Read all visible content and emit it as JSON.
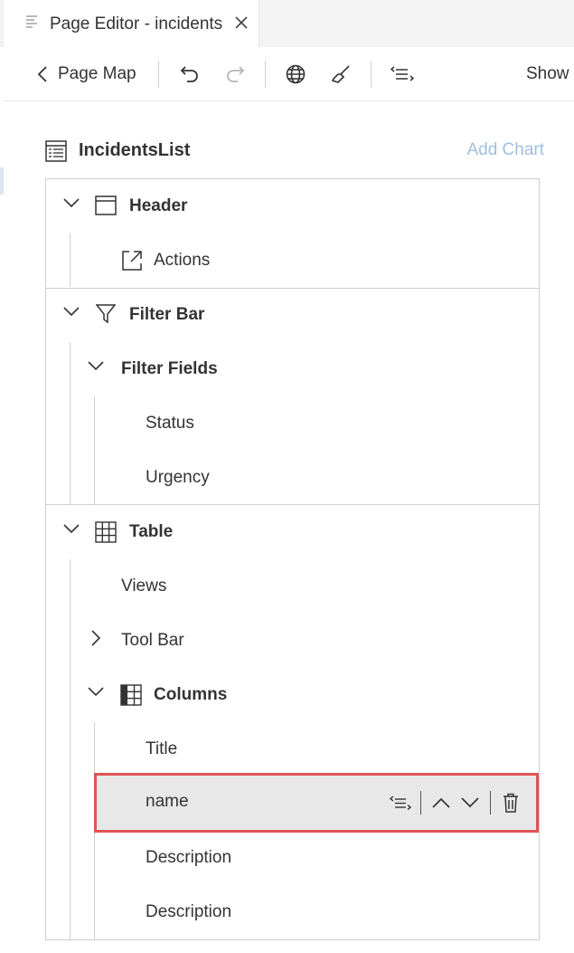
{
  "tab": {
    "title": "Page Editor - incidents",
    "file_icon": "page-lines-icon",
    "close_icon": "close-icon"
  },
  "toolbar": {
    "back_icon": "chevron-left-icon",
    "page_map_label": "Page Map",
    "undo_icon": "undo-icon",
    "redo_icon": "redo-icon",
    "globe_icon": "globe-icon",
    "clean_icon": "broom-icon",
    "navigate_icon": "navigate-to-source-icon",
    "show_label": "Show"
  },
  "outline": {
    "title": "IncidentsList",
    "title_icon": "table-list-icon",
    "add_chart_label": "Add Chart"
  },
  "tree": {
    "header": {
      "label": "Header",
      "icon": "header-layout-icon"
    },
    "actions": {
      "label": "Actions",
      "icon": "external-link-icon"
    },
    "filter_bar": {
      "label": "Filter Bar",
      "icon": "filter-icon"
    },
    "filter_fields": {
      "label": "Filter Fields"
    },
    "status": {
      "label": "Status"
    },
    "urgency": {
      "label": "Urgency"
    },
    "table": {
      "label": "Table",
      "icon": "grid-table-icon"
    },
    "views": {
      "label": "Views"
    },
    "tool_bar": {
      "label": "Tool Bar"
    },
    "columns": {
      "label": "Columns",
      "icon": "columns-icon"
    },
    "col_title": {
      "label": "Title"
    },
    "col_name": {
      "label": "name",
      "actions": [
        "navigate-to-source-icon",
        "move-up-icon",
        "move-down-icon",
        "delete-icon"
      ]
    },
    "col_description_1": {
      "label": "Description"
    },
    "col_description_2": {
      "label": "Description"
    }
  },
  "colors": {
    "selection_outline": "#e05353",
    "selection_background": "#e8e8e8",
    "link_disabled": "#9fc0e0"
  }
}
